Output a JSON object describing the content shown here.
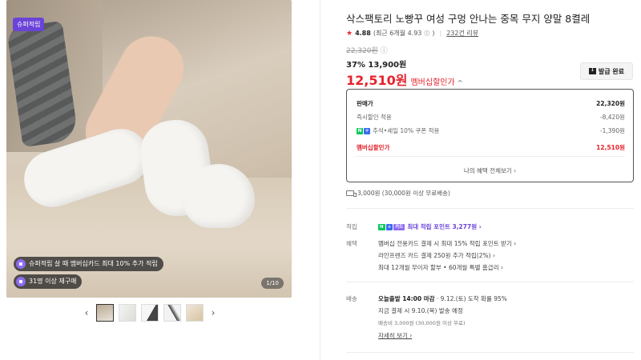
{
  "gallery": {
    "badge": "슈퍼적립",
    "promo_pill_1": "슈퍼적립 살 때 멤버십카드 최대 10% 추가 적립",
    "promo_pill_2": "31명 이상 재구매",
    "counter": "1/10",
    "prev_arrow": "‹",
    "next_arrow": "›",
    "thumbnail_count": 5
  },
  "product": {
    "title": "삭스팩토리 노빵꾸 여성 구멍 안나는 중목 무지 양말 8켤레",
    "rating": {
      "score": "4.88",
      "recent": "(최근 6개월 4.93",
      "recent_close": ")",
      "reviews": "232건 리뷰"
    },
    "original_price": "22,320원",
    "discount": "37% 13,900원",
    "member_price": "12,510원",
    "member_price_label": "멤버십할인가",
    "coupon_button": "발급 완료"
  },
  "price_box": {
    "rows": [
      {
        "label": "판매가",
        "value": "22,320원"
      },
      {
        "label": "즉시할인 적용",
        "value": "-8,420원"
      },
      {
        "label": "추석•세일 10% 쿠폰 적용",
        "value": "-1,390원"
      },
      {
        "label": "멤버십할인가",
        "value": "12,510원"
      }
    ],
    "more_link": "나의 혜택 전체보기 ›"
  },
  "shipping_summary": "3,000원 (30,000원 이상 무료배송)",
  "points": {
    "label": "적립",
    "text": "최대 적립 포인트 3,277원 ›",
    "chip_n": "N",
    "chip_plus": "+",
    "chip_card": "카드"
  },
  "benefits": {
    "label": "혜택",
    "items": [
      "멤버십 전용카드 결제 시 최대 15% 적립 포인트 받기 ›",
      "라인프렌즈 카드 결제 250원 추가 적립(2%) ›",
      "최대 12개월 무이자 할부 • 60개월 특별 홈급리 ›"
    ]
  },
  "delivery": {
    "label": "배송",
    "line1_bold": "오늘출발 14:00 마감",
    "line1_rest": "· 9.12.(토) 도착 확률 95%",
    "line2": "지금 결제 시 9.10.(목) 발송 예정",
    "line3": "배송비 3,000원 (30,000원 이상 무료)",
    "detail_link": "자세히 보기 ›"
  }
}
